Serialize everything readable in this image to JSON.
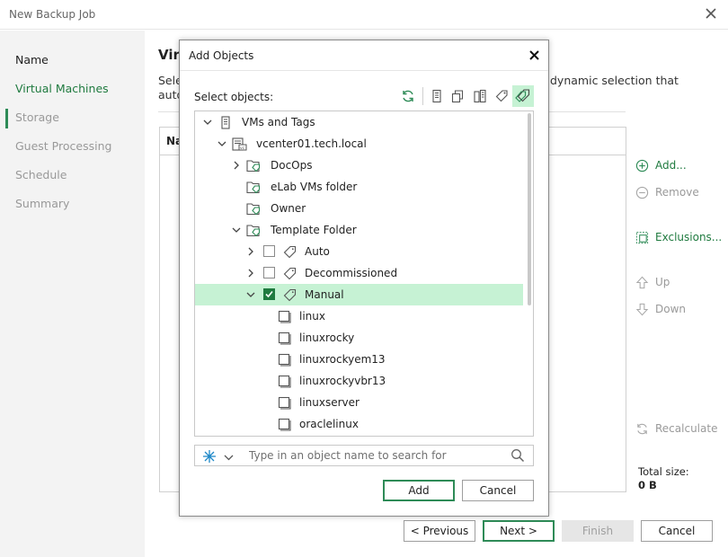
{
  "window": {
    "title": "New Backup Job"
  },
  "sidebar": {
    "items": [
      {
        "label": "Name",
        "state": "done"
      },
      {
        "label": "Virtual Machines",
        "state": "active"
      },
      {
        "label": "Storage",
        "state": "disabled"
      },
      {
        "label": "Guest Processing",
        "state": "disabled"
      },
      {
        "label": "Schedule",
        "state": "disabled"
      },
      {
        "label": "Summary",
        "state": "disabled"
      }
    ]
  },
  "page": {
    "title_partial": "Vir",
    "desc_left_line1": "Sele",
    "desc_left_line2": "auto",
    "desc_right": "dynamic selection that",
    "table_col_partial": "Na"
  },
  "side_buttons": {
    "add": "Add...",
    "remove": "Remove",
    "exclusions": "Exclusions...",
    "up": "Up",
    "down": "Down",
    "recalculate": "Recalculate"
  },
  "totals": {
    "label": "Total size:",
    "value": "0 B"
  },
  "footer": {
    "previous": "< Previous",
    "next": "Next >",
    "finish": "Finish",
    "cancel": "Cancel"
  },
  "dialog": {
    "title": "Add Objects",
    "select_label": "Select objects:",
    "toolbar_icons": [
      "refresh-icon",
      "hosts-and-clusters-icon",
      "vms-and-templates-icon",
      "datastores-icon",
      "tags-icon",
      "vms-and-tags-icon"
    ],
    "tree": [
      {
        "label": "VMs and Tags",
        "level": 0,
        "toggle": "expanded",
        "icon": "vms-and-tags-icon"
      },
      {
        "label": "vcenter01.tech.local",
        "level": 1,
        "toggle": "expanded",
        "icon": "vcenter-icon"
      },
      {
        "label": "DocOps",
        "level": 2,
        "toggle": "collapsed",
        "icon": "tag-category-icon"
      },
      {
        "label": "eLab VMs folder",
        "level": 2,
        "toggle": "none",
        "icon": "tag-category-icon"
      },
      {
        "label": "Owner",
        "level": 2,
        "toggle": "none",
        "icon": "tag-category-icon"
      },
      {
        "label": "Template Folder",
        "level": 2,
        "toggle": "expanded",
        "icon": "tag-category-icon"
      },
      {
        "label": "Auto",
        "level": 3,
        "toggle": "collapsed",
        "icon": "tag-icon",
        "checkbox": false
      },
      {
        "label": "Decommissioned",
        "level": 3,
        "toggle": "collapsed",
        "icon": "tag-icon",
        "checkbox": false
      },
      {
        "label": "Manual",
        "level": 3,
        "toggle": "expanded",
        "icon": "tag-icon",
        "checkbox": true,
        "selected": true
      },
      {
        "label": "linux",
        "level": 4,
        "toggle": "none",
        "icon": "vm-icon"
      },
      {
        "label": "linuxrocky",
        "level": 4,
        "toggle": "none",
        "icon": "vm-icon"
      },
      {
        "label": "linuxrockyem13",
        "level": 4,
        "toggle": "none",
        "icon": "vm-icon"
      },
      {
        "label": "linuxrockyvbr13",
        "level": 4,
        "toggle": "none",
        "icon": "vm-icon"
      },
      {
        "label": "linuxserver",
        "level": 4,
        "toggle": "none",
        "icon": "vm-icon"
      },
      {
        "label": "oraclelinux",
        "level": 4,
        "toggle": "none",
        "icon": "vm-icon"
      }
    ],
    "search": {
      "placeholder": "Type in an object name to search for",
      "value": ""
    },
    "add_button": "Add",
    "cancel_button": "Cancel"
  },
  "colors": {
    "accent": "#2e8b57",
    "selection": "#c6f2d4",
    "disabled_text": "#9a9a9a"
  }
}
